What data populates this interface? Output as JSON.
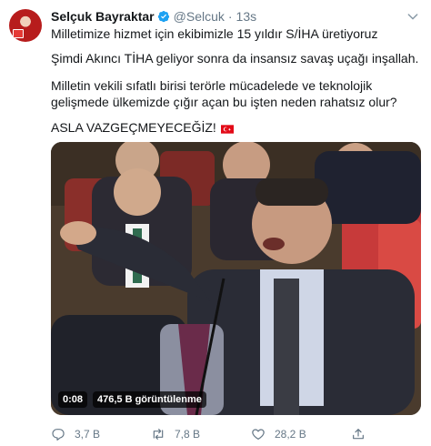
{
  "author": {
    "name": "Selçuk Bayraktar",
    "handle": "@Selcuk",
    "separator": "·",
    "time": "13s"
  },
  "tweet": {
    "line1": "Milletimize hizmet için ekibimizle 15 yıldır S/İHA üretiyoruz",
    "line2": "Şimdi Akıncı TİHA geliyor sonra da insansız savaş uçağı inşallah.",
    "line3": "Milletin vekili sıfatlı birisi terörle mücadelede ve teknolojik gelişmede ülkemizde çığır açan bu işten neden rahatsız olur?",
    "line4": "ASLA VAZGEÇMEYECEĞİZ!"
  },
  "video": {
    "duration": "0:08",
    "views": "476,5 B görüntülenme"
  },
  "actions": {
    "replies": "3,7 B",
    "retweets": "7,8 B",
    "likes": "28,2 B"
  },
  "colors": {
    "text": "#14171a",
    "secondary": "#657786",
    "verified": "#1da1f2",
    "flag_red": "#e30a17"
  },
  "icons": [
    "verified-badge-icon",
    "chevron-down-icon",
    "turkey-flag-icon",
    "reply-icon",
    "retweet-icon",
    "like-icon",
    "share-icon"
  ]
}
